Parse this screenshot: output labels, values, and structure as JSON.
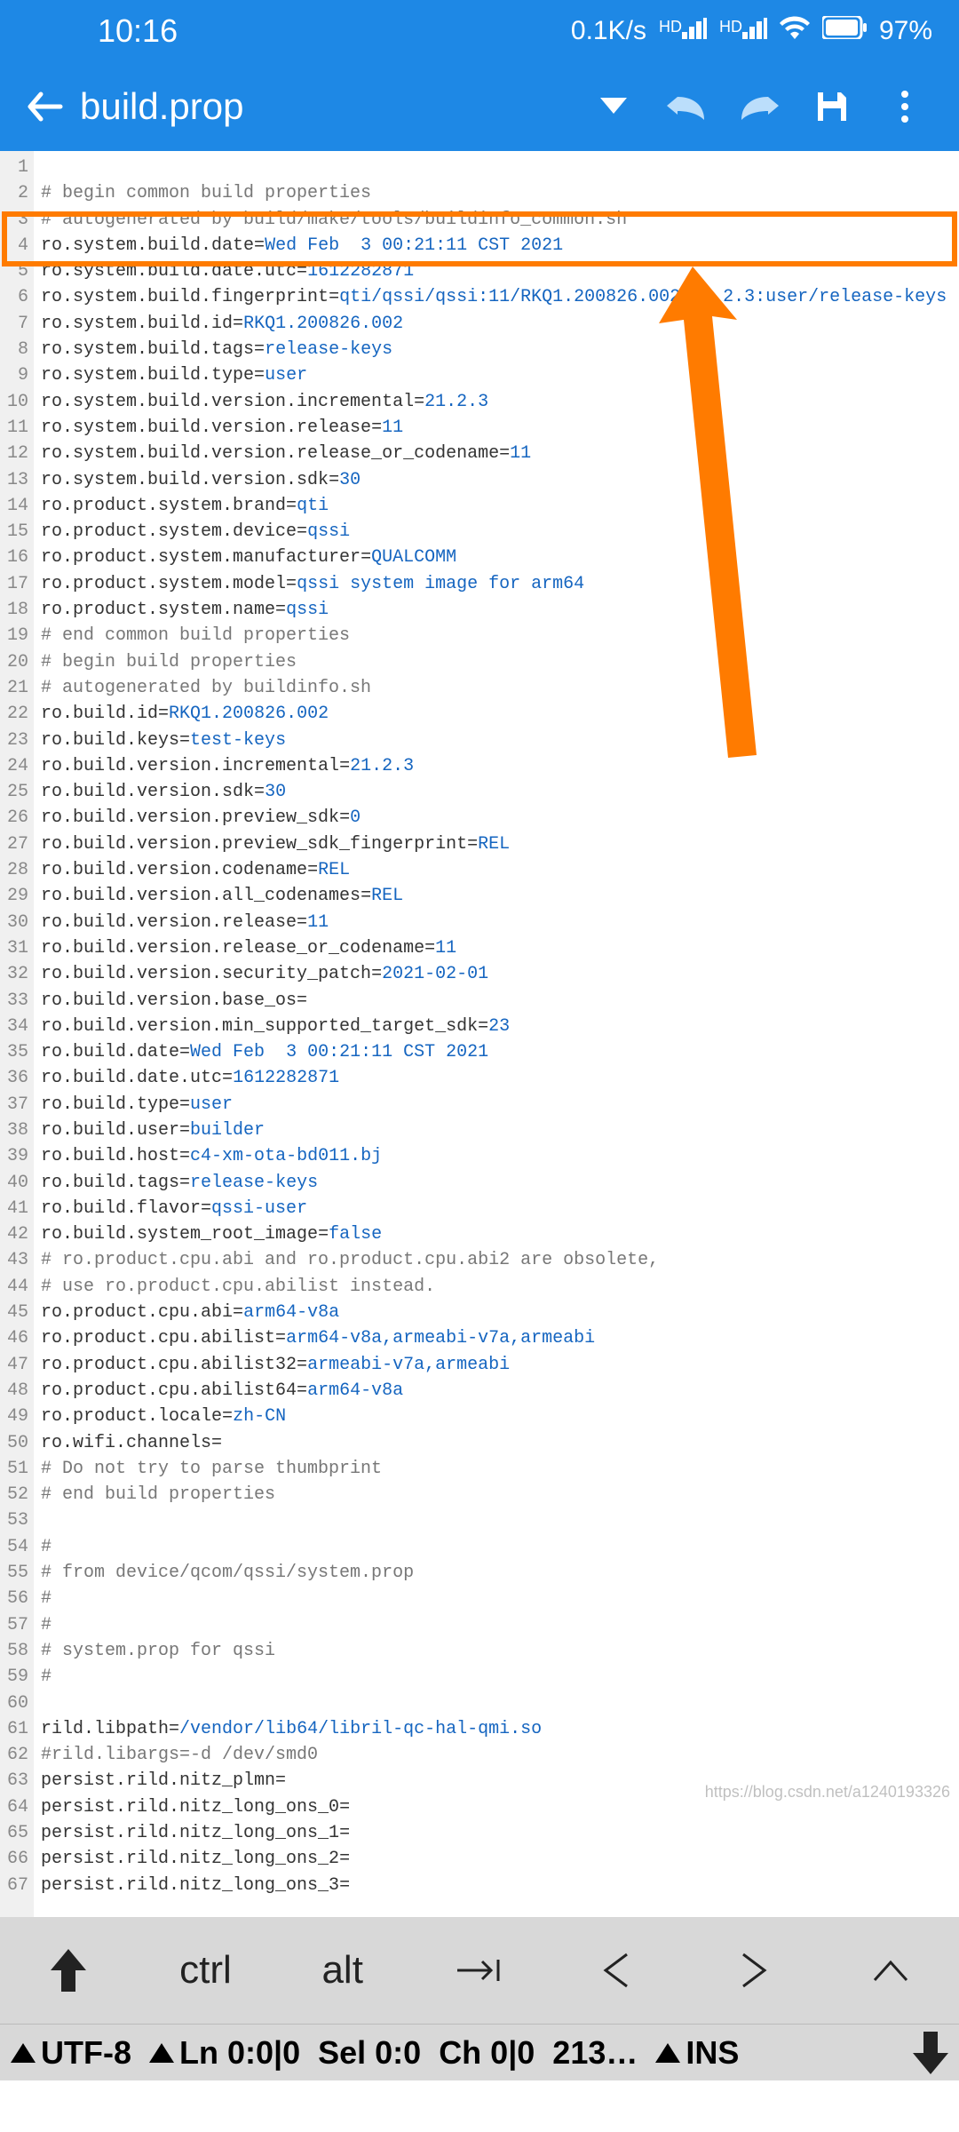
{
  "status": {
    "time": "10:16",
    "speed": "0.1K/s",
    "hd1": "HD",
    "hd2": "HD",
    "battery": "97%"
  },
  "appbar": {
    "title": "build.prop"
  },
  "lines": [
    {
      "n": 1,
      "t": ""
    },
    {
      "n": 2,
      "t": "# begin common build properties",
      "com": true
    },
    {
      "n": 3,
      "t": "# autogenerated by build/make/tools/buildinfo_common.sh",
      "com": true
    },
    {
      "n": 4,
      "k": "ro.system.build.date",
      "v": "Wed Feb  3 00:21:11 CST 2021"
    },
    {
      "n": 5,
      "k": "ro.system.build.date.utc",
      "v": "1612282871"
    },
    {
      "n": 6,
      "k": "ro.system.build.fingerprint",
      "v": "qti/qssi/qssi:11/RKQ1.200826.002/21.2.3:user/release-keys"
    },
    {
      "n": 7,
      "k": "ro.system.build.id",
      "v": "RKQ1.200826.002"
    },
    {
      "n": 8,
      "k": "ro.system.build.tags",
      "v": "release-keys"
    },
    {
      "n": 9,
      "k": "ro.system.build.type",
      "v": "user"
    },
    {
      "n": 10,
      "k": "ro.system.build.version.incremental",
      "v": "21.2.3"
    },
    {
      "n": 11,
      "k": "ro.system.build.version.release",
      "v": "11"
    },
    {
      "n": 12,
      "k": "ro.system.build.version.release_or_codename",
      "v": "11"
    },
    {
      "n": 13,
      "k": "ro.system.build.version.sdk",
      "v": "30"
    },
    {
      "n": 14,
      "k": "ro.product.system.brand",
      "v": "qti"
    },
    {
      "n": 15,
      "k": "ro.product.system.device",
      "v": "qssi"
    },
    {
      "n": 16,
      "k": "ro.product.system.manufacturer",
      "v": "QUALCOMM"
    },
    {
      "n": 17,
      "k": "ro.product.system.model",
      "v": "qssi system image for arm64"
    },
    {
      "n": 18,
      "k": "ro.product.system.name",
      "v": "qssi"
    },
    {
      "n": 19,
      "t": "# end common build properties",
      "com": true
    },
    {
      "n": 20,
      "t": "# begin build properties",
      "com": true
    },
    {
      "n": 21,
      "t": "# autogenerated by buildinfo.sh",
      "com": true
    },
    {
      "n": 22,
      "k": "ro.build.id",
      "v": "RKQ1.200826.002"
    },
    {
      "n": 23,
      "k": "ro.build.keys",
      "v": "test-keys"
    },
    {
      "n": 24,
      "k": "ro.build.version.incremental",
      "v": "21.2.3"
    },
    {
      "n": 25,
      "k": "ro.build.version.sdk",
      "v": "30"
    },
    {
      "n": 26,
      "k": "ro.build.version.preview_sdk",
      "v": "0"
    },
    {
      "n": 27,
      "k": "ro.build.version.preview_sdk_fingerprint",
      "v": "REL"
    },
    {
      "n": 28,
      "k": "ro.build.version.codename",
      "v": "REL"
    },
    {
      "n": 29,
      "k": "ro.build.version.all_codenames",
      "v": "REL"
    },
    {
      "n": 30,
      "k": "ro.build.version.release",
      "v": "11"
    },
    {
      "n": 31,
      "k": "ro.build.version.release_or_codename",
      "v": "11"
    },
    {
      "n": 32,
      "k": "ro.build.version.security_patch",
      "v": "2021-02-01"
    },
    {
      "n": 33,
      "k": "ro.build.version.base_os",
      "v": ""
    },
    {
      "n": 34,
      "k": "ro.build.version.min_supported_target_sdk",
      "v": "23"
    },
    {
      "n": 35,
      "k": "ro.build.date",
      "v": "Wed Feb  3 00:21:11 CST 2021"
    },
    {
      "n": 36,
      "k": "ro.build.date.utc",
      "v": "1612282871"
    },
    {
      "n": 37,
      "k": "ro.build.type",
      "v": "user"
    },
    {
      "n": 38,
      "k": "ro.build.user",
      "v": "builder"
    },
    {
      "n": 39,
      "k": "ro.build.host",
      "v": "c4-xm-ota-bd011.bj"
    },
    {
      "n": 40,
      "k": "ro.build.tags",
      "v": "release-keys"
    },
    {
      "n": 41,
      "k": "ro.build.flavor",
      "v": "qssi-user"
    },
    {
      "n": 42,
      "k": "ro.build.system_root_image",
      "v": "false"
    },
    {
      "n": 43,
      "t": "# ro.product.cpu.abi and ro.product.cpu.abi2 are obsolete,",
      "com": true
    },
    {
      "n": 44,
      "t": "# use ro.product.cpu.abilist instead.",
      "com": true
    },
    {
      "n": 45,
      "k": "ro.product.cpu.abi",
      "v": "arm64-v8a"
    },
    {
      "n": 46,
      "k": "ro.product.cpu.abilist",
      "v": "arm64-v8a,armeabi-v7a,armeabi"
    },
    {
      "n": 47,
      "k": "ro.product.cpu.abilist32",
      "v": "armeabi-v7a,armeabi"
    },
    {
      "n": 48,
      "k": "ro.product.cpu.abilist64",
      "v": "arm64-v8a"
    },
    {
      "n": 49,
      "k": "ro.product.locale",
      "v": "zh-CN"
    },
    {
      "n": 50,
      "k": "ro.wifi.channels",
      "v": ""
    },
    {
      "n": 51,
      "t": "# Do not try to parse thumbprint",
      "com": true
    },
    {
      "n": 52,
      "t": "# end build properties",
      "com": true
    },
    {
      "n": 53,
      "t": ""
    },
    {
      "n": 54,
      "t": "#",
      "com": true
    },
    {
      "n": 55,
      "t": "# from device/qcom/qssi/system.prop",
      "com": true
    },
    {
      "n": 56,
      "t": "#",
      "com": true
    },
    {
      "n": 57,
      "t": "#",
      "com": true
    },
    {
      "n": 58,
      "t": "# system.prop for qssi",
      "com": true
    },
    {
      "n": 59,
      "t": "#",
      "com": true
    },
    {
      "n": 60,
      "t": ""
    },
    {
      "n": 61,
      "k": "rild.libpath",
      "v": "/vendor/lib64/libril-qc-hal-qmi.so"
    },
    {
      "n": 62,
      "t": "#rild.libargs=-d /dev/smd0",
      "com": true
    },
    {
      "n": 63,
      "k": "persist.rild.nitz_plmn",
      "v": ""
    },
    {
      "n": 64,
      "k": "persist.rild.nitz_long_ons_0",
      "v": ""
    },
    {
      "n": 65,
      "k": "persist.rild.nitz_long_ons_1",
      "v": ""
    },
    {
      "n": 66,
      "k": "persist.rild.nitz_long_ons_2",
      "v": ""
    },
    {
      "n": 67,
      "k": "persist.rild.nitz_long_ons_3",
      "v": ""
    }
  ],
  "keyboard": {
    "ctrl": "ctrl",
    "alt": "alt"
  },
  "statusline": {
    "encoding": "UTF-8",
    "ln": "Ln 0:0|0",
    "sel": "Sel 0:0",
    "ch": "Ch 0|0",
    "extra": "213…",
    "mode": "INS"
  },
  "watermark": "https://blog.csdn.net/a1240193326"
}
